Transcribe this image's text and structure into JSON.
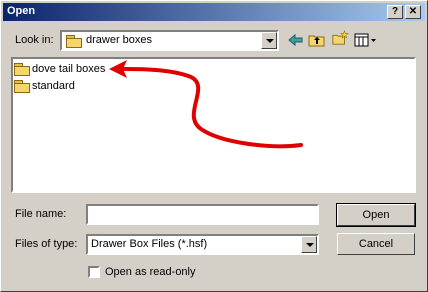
{
  "window": {
    "title": "Open",
    "help_glyph": "?",
    "close_glyph": "✕"
  },
  "toolbar": {
    "look_in_label": "Look in:",
    "look_in_value": "drawer boxes",
    "icons": [
      "back-arrow-icon",
      "up-folder-icon",
      "new-folder-icon",
      "views-menu-icon"
    ]
  },
  "files": [
    {
      "name": "dove tail boxes",
      "icon": "folder-icon"
    },
    {
      "name": "standard",
      "icon": "folder-icon"
    }
  ],
  "annotation": {
    "color": "#e00000"
  },
  "fields": {
    "file_name_label": "File name:",
    "file_name_value": "",
    "files_of_type_label": "Files of type:",
    "files_of_type_value": "Drawer Box Files (*.hsf)"
  },
  "buttons": {
    "open": "Open",
    "cancel": "Cancel"
  },
  "read_only_label": "Open as read-only",
  "read_only_checked": false
}
